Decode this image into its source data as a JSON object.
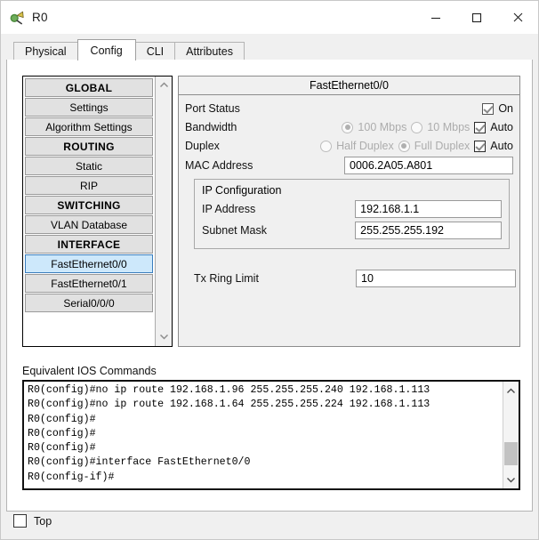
{
  "window": {
    "title": "R0",
    "icon": "router-icon",
    "controls": {
      "minimize": "minimize-icon",
      "maximize": "maximize-icon",
      "close": "close-icon"
    }
  },
  "tabs": [
    {
      "label": "Physical",
      "active": false
    },
    {
      "label": "Config",
      "active": true
    },
    {
      "label": "CLI",
      "active": false
    },
    {
      "label": "Attributes",
      "active": false
    }
  ],
  "sidebar": {
    "items": [
      {
        "label": "GLOBAL",
        "type": "header"
      },
      {
        "label": "Settings",
        "type": "item"
      },
      {
        "label": "Algorithm Settings",
        "type": "item"
      },
      {
        "label": "ROUTING",
        "type": "header"
      },
      {
        "label": "Static",
        "type": "item"
      },
      {
        "label": "RIP",
        "type": "item"
      },
      {
        "label": "SWITCHING",
        "type": "header"
      },
      {
        "label": "VLAN Database",
        "type": "item"
      },
      {
        "label": "INTERFACE",
        "type": "header"
      },
      {
        "label": "FastEthernet0/0",
        "type": "item",
        "selected": true
      },
      {
        "label": "FastEthernet0/1",
        "type": "item"
      },
      {
        "label": "Serial0/0/0",
        "type": "item"
      }
    ],
    "scroll_up": "chevron-up-icon",
    "scroll_down": "chevron-down-icon"
  },
  "config": {
    "panel_title": "FastEthernet0/0",
    "port_status": {
      "label": "Port Status",
      "checkbox_label": "On",
      "checked": true
    },
    "bandwidth": {
      "label": "Bandwidth",
      "option_100": "100 Mbps",
      "option_10": "10 Mbps",
      "selected": "100 Mbps",
      "auto_label": "Auto",
      "auto_checked": true
    },
    "duplex": {
      "label": "Duplex",
      "option_half": "Half Duplex",
      "option_full": "Full Duplex",
      "selected": "Full Duplex",
      "auto_label": "Auto",
      "auto_checked": true
    },
    "mac_address": {
      "label": "MAC Address",
      "value": "0006.2A05.A801"
    },
    "ip_configuration": {
      "title": "IP Configuration",
      "ip_address": {
        "label": "IP Address",
        "value": "192.168.1.1"
      },
      "subnet_mask": {
        "label": "Subnet Mask",
        "value": "255.255.255.192"
      }
    },
    "tx_ring_limit": {
      "label": "Tx Ring Limit",
      "value": "10"
    }
  },
  "ios": {
    "label": "Equivalent IOS Commands",
    "lines": [
      "R0(config)#no ip route 192.168.1.96 255.255.255.240 192.168.1.113",
      "R0(config)#no ip route 192.168.1.64 255.255.255.224 192.168.1.113",
      "R0(config)#",
      "R0(config)#",
      "R0(config)#",
      "R0(config)#interface FastEthernet0/0",
      "R0(config-if)#"
    ],
    "scroll_up": "chevron-up-icon",
    "scroll_down": "chevron-down-icon"
  },
  "footer": {
    "top_checkbox_label": "Top",
    "top_checked": false
  },
  "colors": {
    "selection": "#cde8fb",
    "selection_border": "#3a7dbd",
    "button_face": "#e1e1e1",
    "panel": "#f0f0f0"
  }
}
